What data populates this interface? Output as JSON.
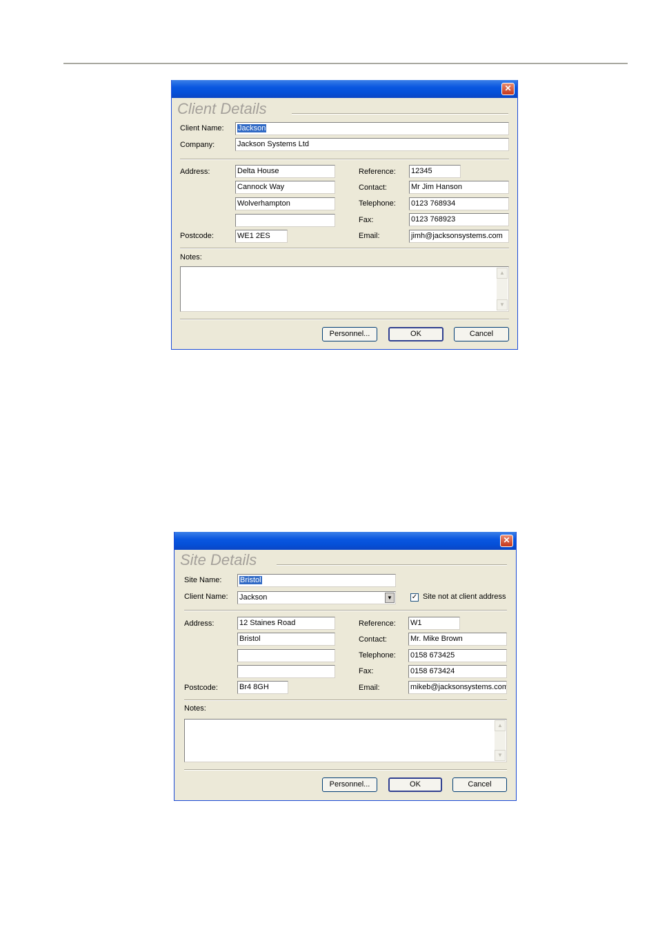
{
  "client": {
    "title": "Client Details",
    "close_glyph": "✕",
    "labels": {
      "client_name": "Client Name:",
      "company": "Company:",
      "address": "Address:",
      "postcode": "Postcode:",
      "reference": "Reference:",
      "contact": "Contact:",
      "telephone": "Telephone:",
      "fax": "Fax:",
      "email": "Email:",
      "notes": "Notes:"
    },
    "values": {
      "client_name": "Jackson",
      "company": "Jackson Systems Ltd",
      "address_1": "Delta House",
      "address_2": "Cannock Way",
      "address_3": "Wolverhampton",
      "address_4": "",
      "postcode": "WE1 2ES",
      "reference": "12345",
      "contact": "Mr Jim Hanson",
      "telephone": "0123 768934",
      "fax": "0123 768923",
      "email": "jimh@jacksonsystems.com",
      "notes": ""
    },
    "buttons": {
      "personnel": "Personnel...",
      "ok": "OK",
      "cancel": "Cancel"
    }
  },
  "site": {
    "title": "Site Details",
    "close_glyph": "✕",
    "labels": {
      "site_name": "Site Name:",
      "client_name": "Client Name:",
      "not_at_client": "Site not at client address",
      "address": "Address:",
      "postcode": "Postcode:",
      "reference": "Reference:",
      "contact": "Contact:",
      "telephone": "Telephone:",
      "fax": "Fax:",
      "email": "Email:",
      "notes": "Notes:"
    },
    "values": {
      "site_name": "Bristol",
      "client_name": "Jackson",
      "not_at_client_checked": true,
      "address_1": "12 Staines Road",
      "address_2": "Bristol",
      "address_3": "",
      "address_4": "",
      "postcode": "Br4 8GH",
      "reference": "W1",
      "contact": "Mr. Mike Brown",
      "telephone": "0158 673425",
      "fax": "0158 673424",
      "email": "mikeb@jacksonsystems.com",
      "notes": ""
    },
    "buttons": {
      "personnel": "Personnel...",
      "ok": "OK",
      "cancel": "Cancel"
    }
  }
}
